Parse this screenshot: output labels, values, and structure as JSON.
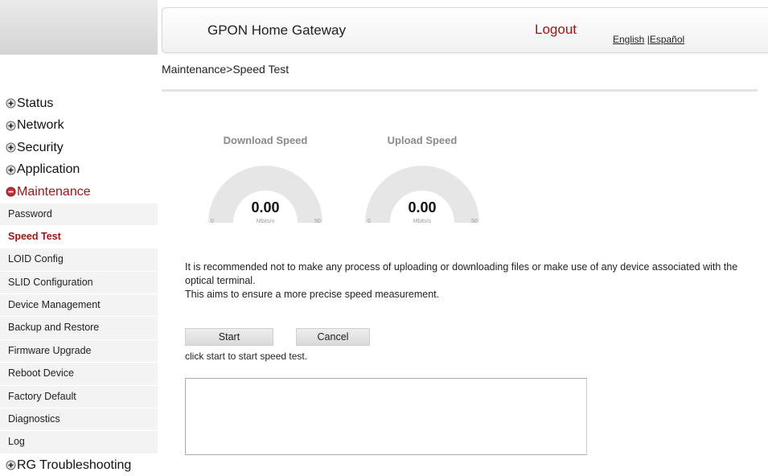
{
  "header": {
    "title": "GPON Home Gateway",
    "logout": "Logout",
    "lang_english": "English",
    "lang_separator": " |",
    "lang_spanish": "Español"
  },
  "breadcrumb": "Maintenance>Speed Test",
  "sidebar": {
    "sections": [
      {
        "label": "Status",
        "expanded": false
      },
      {
        "label": "Network",
        "expanded": false
      },
      {
        "label": "Security",
        "expanded": false
      },
      {
        "label": "Application",
        "expanded": false
      },
      {
        "label": "Maintenance",
        "expanded": true
      }
    ],
    "maintenance_items": [
      {
        "label": "Password"
      },
      {
        "label": "Speed Test",
        "active": true
      },
      {
        "label": "LOID Config"
      },
      {
        "label": "SLID Configuration"
      },
      {
        "label": "Device Management"
      },
      {
        "label": "Backup and Restore"
      },
      {
        "label": "Firmware Upgrade"
      },
      {
        "label": "Reboot Device"
      },
      {
        "label": "Factory Default"
      },
      {
        "label": "Diagnostics"
      },
      {
        "label": "Log"
      }
    ],
    "last_section": {
      "label": "RG Troubleshooting",
      "expanded": false
    }
  },
  "gauges": {
    "download": {
      "label": "Download Speed",
      "value": "0.00",
      "unit": "Mbits/s",
      "min": "0",
      "max": "50"
    },
    "upload": {
      "label": "Upload Speed",
      "value": "0.00",
      "unit": "Mbits/s",
      "min": "0",
      "max": "50"
    }
  },
  "notice": {
    "line1": "It is recommended not to make any process of uploading or downloading files or make use of any device associated with the optical terminal.",
    "line2": "This aims to ensure a more precise speed measurement."
  },
  "buttons": {
    "start": "Start",
    "cancel": "Cancel"
  },
  "hint": "click start to start speed test.",
  "result_text": "",
  "colors": {
    "accent": "#a01616",
    "gauge_track": "#e6e6e6",
    "sidebar_bg": "#f3f3f3"
  }
}
